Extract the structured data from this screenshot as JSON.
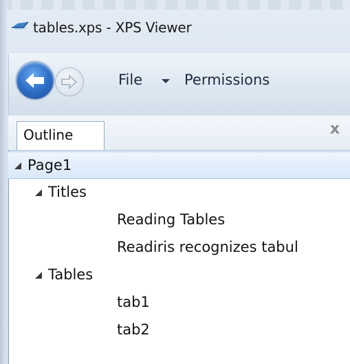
{
  "window": {
    "title": "tables.xps - XPS Viewer",
    "app_icon": "xps-viewer-icon"
  },
  "toolbar": {
    "back_icon": "back-arrow-icon",
    "forward_icon": "forward-arrow-icon",
    "file_label": "File",
    "permissions_label": "Permissions"
  },
  "pane": {
    "tab_label": "Outline",
    "close_label": "x"
  },
  "outline": {
    "items": [
      {
        "label": "Page1",
        "expanded": true,
        "selected": true
      },
      {
        "label": "Titles",
        "expanded": true
      },
      {
        "label": "Reading Tables"
      },
      {
        "label": "Readiris recognizes tabul"
      },
      {
        "label": "Tables",
        "expanded": true
      },
      {
        "label": "tab1"
      },
      {
        "label": "tab2"
      }
    ]
  },
  "colors": {
    "accent": "#2f6fc8",
    "selection": "#d9e8f9"
  }
}
